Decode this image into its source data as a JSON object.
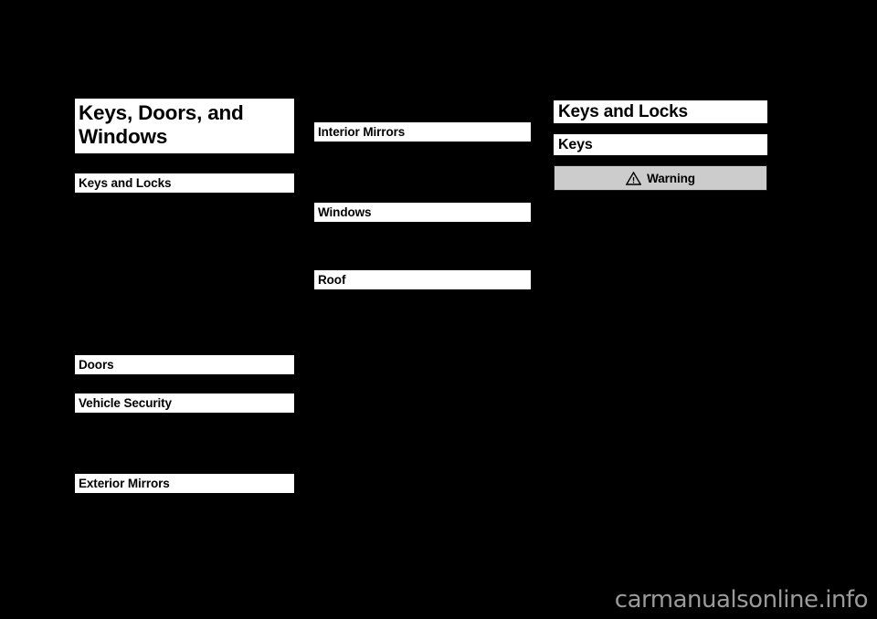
{
  "page": {
    "background_color": "#000000",
    "band_color": "#ffffff",
    "band_text_color": "#000000"
  },
  "left_column": {
    "chapter_title": {
      "line1": "Keys, Doors, and",
      "line2": "Windows"
    },
    "sections": [
      {
        "label": "Keys and Locks"
      },
      {
        "label": "Doors"
      },
      {
        "label": "Vehicle Security"
      },
      {
        "label": "Exterior Mirrors"
      }
    ]
  },
  "middle_column": {
    "sections": [
      {
        "label": "Interior Mirrors"
      },
      {
        "label": "Windows"
      },
      {
        "label": "Roof"
      }
    ]
  },
  "right_column": {
    "title": "Keys and Locks",
    "subtitle": "Keys",
    "warning": {
      "label": "Warning",
      "icon": "warning-triangle-icon",
      "background_color": "#cccccc",
      "border_color": "#1a1a1a"
    }
  },
  "watermark": {
    "text": "carmanualsonline.info",
    "color": "#9a9a9a"
  }
}
